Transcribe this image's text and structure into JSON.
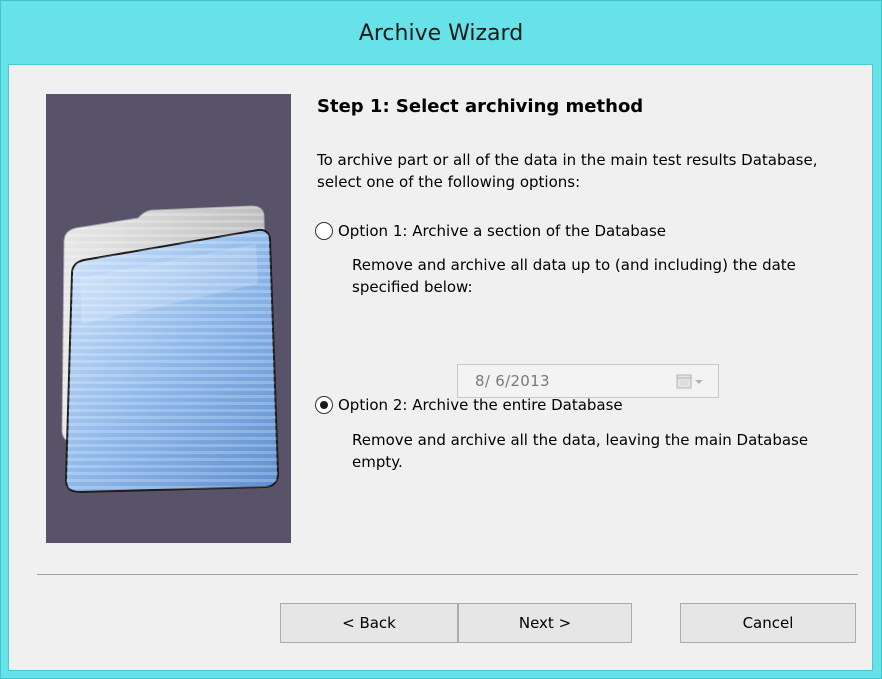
{
  "window": {
    "title": "Archive Wizard"
  },
  "step": {
    "title": "Step 1: Select archiving method",
    "intro": "To archive part or all of the data in the main test results Database, select one of the following options:"
  },
  "options": [
    {
      "label": "Option 1: Archive a section of the Database",
      "description": "Remove and archive all data up to (and including) the date specified below:",
      "selected": false
    },
    {
      "label": "Option 2: Archive the entire Database",
      "description": "Remove and archive all the data, leaving the main Database empty.",
      "selected": true
    }
  ],
  "date_picker": {
    "value": "8/ 6/2013",
    "enabled": false,
    "icon": "calendar-icon"
  },
  "buttons": {
    "back": "< Back",
    "next": "Next >",
    "cancel": "Cancel"
  },
  "colors": {
    "titlebar": "#66e2e8",
    "client_background": "#f0f0f0",
    "side_image_background": "#595369",
    "folder_blue": "#8fb8ea"
  },
  "side_image": {
    "icon": "folder-icon"
  }
}
